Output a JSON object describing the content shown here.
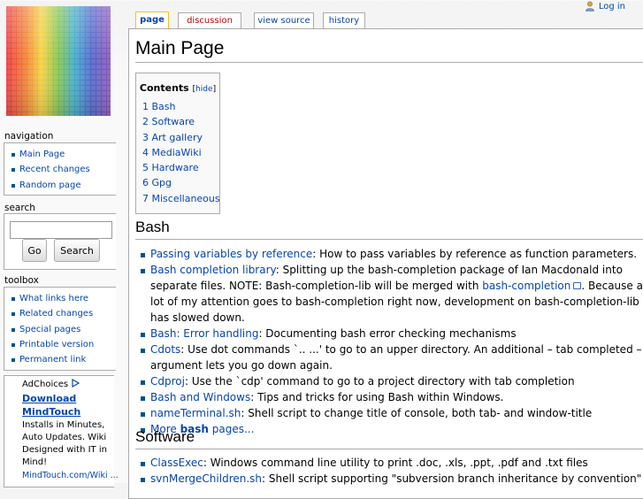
{
  "personal": {
    "login": "Log in"
  },
  "tabs": [
    {
      "label": "page",
      "selected": true
    },
    {
      "label": "discussion",
      "new": true
    },
    {
      "label": "view source"
    },
    {
      "label": "history"
    }
  ],
  "page_title": "Main Page",
  "toc": {
    "title": "Contents",
    "hide": "hide",
    "items": [
      {
        "num": "1",
        "label": "Bash"
      },
      {
        "num": "2",
        "label": "Software"
      },
      {
        "num": "3",
        "label": "Art gallery"
      },
      {
        "num": "4",
        "label": "MediaWiki"
      },
      {
        "num": "5",
        "label": "Hardware"
      },
      {
        "num": "6",
        "label": "Gpg"
      },
      {
        "num": "7",
        "label": "Miscellaneous"
      }
    ]
  },
  "sections": {
    "bash": {
      "title": "Bash",
      "items": [
        {
          "link": "Passing variables by reference",
          "text": ": How to pass variables by reference as function parameters."
        },
        {
          "link": "Bash completion library",
          "text": ": Splitting up the bash-completion package of Ian Macdonald into separate files. NOTE: Bash-completion-lib will be merged with ",
          "ext_link": "bash-completion",
          "text2": ". Because a lot of my attention goes to bash-completion right now, development on bash-completion-lib has slowed down."
        },
        {
          "link": "Bash: Error handling",
          "text": ": Documenting bash error checking mechanisms"
        },
        {
          "link": "Cdots",
          "text": ": Use dot commands `.. ...' to go to an upper directory. An additional – tab completed – argument lets you go down again."
        },
        {
          "link": "Cdproj",
          "text": ": Use the `cdp' command to go to a project directory with tab completion"
        },
        {
          "link": "Bash and Windows",
          "text": ": Tips and tricks for using Bash within Windows."
        },
        {
          "link": "nameTerminal.sh",
          "text": ": Shell script to change title of console, both tab- and window-title"
        },
        {
          "more_pre": "More ",
          "more_bold": "bash",
          "more_post": " pages..."
        }
      ]
    },
    "software": {
      "title": "Software",
      "items": [
        {
          "link": "ClassExec",
          "text": ": Windows command line utility to print .doc, .xls, .ppt, .pdf and .txt files"
        },
        {
          "link": "svnMergeChildren.sh",
          "text": ": Shell script supporting \"subversion branch inheritance by convention\""
        }
      ]
    }
  },
  "sidebar": {
    "navigation": {
      "title": "navigation",
      "items": [
        "Main Page",
        "Recent changes",
        "Random page"
      ]
    },
    "search": {
      "title": "search",
      "value": "",
      "go": "Go",
      "search": "Search"
    },
    "toolbox": {
      "title": "toolbox",
      "items": [
        "What links here",
        "Related changes",
        "Special pages",
        "Printable version",
        "Permanent link"
      ]
    }
  },
  "ad": {
    "adchoices": "AdChoices",
    "title": "Download MindTouch",
    "text": "Installs in Minutes, Auto Updates. Wiki Designed with IT in Mind!",
    "url": "MindTouch.com/Wiki ..."
  },
  "colors": {
    "link": "#0645ad",
    "new_link": "#ba0000",
    "bullet": "#00528c",
    "selected_tab_border": "#fabd23"
  }
}
